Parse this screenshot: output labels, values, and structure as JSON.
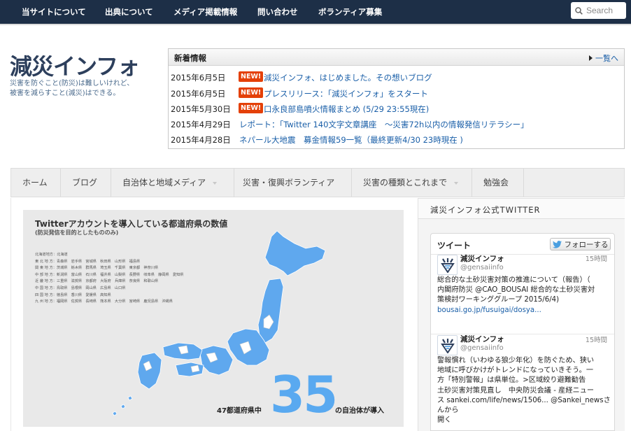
{
  "topnav": {
    "items": [
      "当サイトについて",
      "出典について",
      "メディア掲載情報",
      "問い合わせ",
      "ボランティア募集"
    ],
    "search_placeholder": "Search"
  },
  "logo": {
    "title": "減災インフォ",
    "tagline_line1": "災害を防ぐこと(防災)は難しいけれど、",
    "tagline_line2": "被害を減らすこと(減災)はできる。"
  },
  "news": {
    "title": "新着情報",
    "more_label": "一覧へ",
    "new_badge": "NEW!",
    "items": [
      {
        "date": "2015年6月5日",
        "new": true,
        "title": "減災インフォ、はじめました。その想いブログ"
      },
      {
        "date": "2015年6月5日",
        "new": true,
        "title": "プレスリリース：「減災インフォ」をスタート"
      },
      {
        "date": "2015年5月30日",
        "new": true,
        "title": "口永良部島噴火情報まとめ (5/29 23:55現在)"
      },
      {
        "date": "2015年4月29日",
        "new": false,
        "title": "レポート：「Twitter 140文字文章講座　～災害72h以内の情報発信リテラシー」"
      },
      {
        "date": "2015年4月28日",
        "new": false,
        "title": "ネパール大地震　募金情報59一覧（最終更新4/30 23時現在 )"
      }
    ]
  },
  "menu": {
    "items": [
      {
        "label": "ホーム",
        "dropdown": false
      },
      {
        "label": "ブログ",
        "dropdown": false
      },
      {
        "label": "自治体と地域メディア",
        "dropdown": true
      },
      {
        "label": "災害・復興ボランティア",
        "dropdown": false
      },
      {
        "label": "災害の種類とこれまで",
        "dropdown": true
      },
      {
        "label": "勉強会",
        "dropdown": false
      }
    ]
  },
  "infographic": {
    "title": "Twitterアカウントを導入している都道府県の数値",
    "subtitle": "(防災発信を目的としたもののみ)",
    "regions": [
      "北海道地方：北海道",
      "東 北 地 方：青森県　岩手県　宮城県　秋田県　山形県　福島県",
      "関 東 地 方：茨城県　栃木県　群馬県　埼玉県　千葉県　東京都　神奈川県",
      "中 部 地 方：新潟県　富山県　石川県　福井県　山梨県　長野県　岐阜県　静岡県　愛知県",
      "近 畿 地 方：三重県　滋賀県　京都府　大阪府　兵庫県　奈良県　和歌山県",
      "中 国 地 方：鳥取県　島根県　岡山県　広島県　山口県",
      "四 国 地 方：徳島県　香川県　愛媛県　高知県",
      "九 州 地 方：福岡県　佐賀県　長崎県　熊本県　大分県　宮崎県　鹿児島県　沖縄県"
    ],
    "label_prefix": "47都道府県中",
    "count": "35",
    "label_suffix": "の自治体が導入",
    "accent_color": "#59a9f0"
  },
  "sidebar": {
    "title": "減災インフォ公式TWITTER",
    "widget_title": "ツイート",
    "follow_label": "フォローする",
    "tweets": [
      {
        "name": "減災インフォ",
        "handle": "@gensaiinfo",
        "time": "15時間",
        "lines": [
          "総合的な土砂災害対策の推進について（報告）（",
          "内閣府防災 @CAO_BOUSAI 総合的な土砂災害対",
          "策検討ワーキンググループ 2015/6/4)",
          "bousai.go.jp/fusuigai/dosya..."
        ]
      },
      {
        "name": "減災インフォ",
        "handle": "@gensaiinfo",
        "time": "15時間",
        "lines": [
          "警報慣れ（いわゆる狼少年化）を防ぐため、狭い",
          "地域に呼びかけがトレンドになっていきそう。一",
          "方「特別警報」は県単位。>区域絞り避難勧告",
          "土砂災害対策見直し　中央防災会議 - 産経ニュー",
          "ス sankei.com/life/news/1506... @Sankei_newsさ",
          "んから",
          "開く"
        ]
      }
    ]
  }
}
